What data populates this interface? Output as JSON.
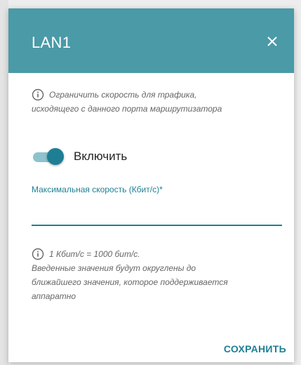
{
  "dialog": {
    "title": "LAN1",
    "close_icon": "close-icon",
    "header_color": "#4a9aa8",
    "accent_color": "#1e7f94"
  },
  "info": {
    "line1": "Ограничить скорость для трафика,",
    "line2": "исходящего с данного порта маршрутизатора"
  },
  "toggle": {
    "label": "Включить",
    "state": "on"
  },
  "max_speed": {
    "label": "Максимальная скорость (Кбит/с)*",
    "value": "",
    "placeholder": ""
  },
  "note": {
    "line1": "1 Кбит/с = 1000 бит/с.",
    "line2": "Введенные значения будут округлены до",
    "line3": "ближайшего значения, которое поддерживается",
    "line4": "аппаратно"
  },
  "actions": {
    "save_label": "СОХРАНИТЬ"
  }
}
